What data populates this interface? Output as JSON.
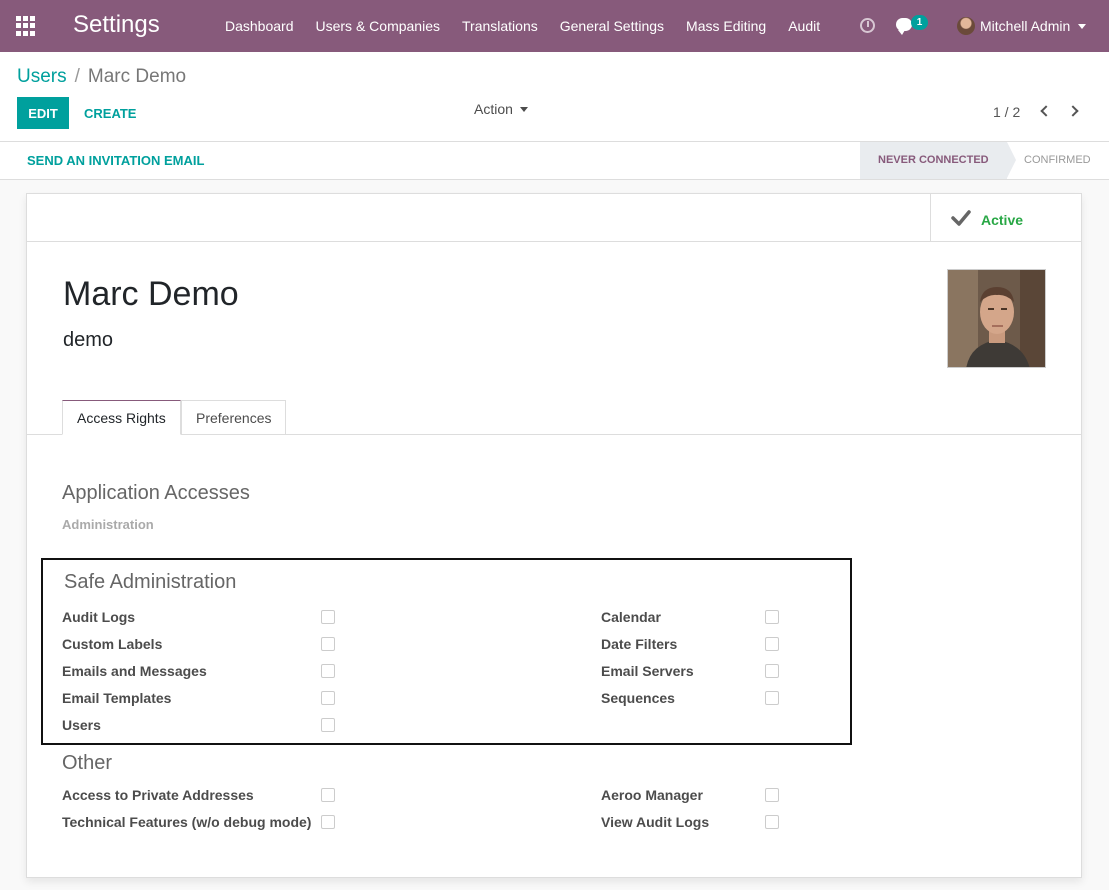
{
  "navbar": {
    "app_title": "Settings",
    "menu": [
      "Dashboard",
      "Users & Companies",
      "Translations",
      "General Settings",
      "Mass Editing",
      "Audit"
    ],
    "chat_badge": "1",
    "user_name": "Mitchell Admin"
  },
  "control_panel": {
    "breadcrumb_parent": "Users",
    "breadcrumb_separator": "/",
    "breadcrumb_current": "Marc Demo",
    "edit_label": "EDIT",
    "create_label": "CREATE",
    "action_label": "Action",
    "pager": "1 / 2"
  },
  "statusbar": {
    "invite_label": "SEND AN INVITATION EMAIL",
    "states": [
      "NEVER CONNECTED",
      "CONFIRMED"
    ],
    "current_state": "NEVER CONNECTED"
  },
  "record": {
    "active_label": "Active",
    "name": "Marc Demo",
    "login": "demo"
  },
  "tabs": [
    "Access Rights",
    "Preferences"
  ],
  "access_rights": {
    "application_accesses": {
      "title": "Application Accesses",
      "category": "Administration"
    },
    "safe_administration": {
      "title": "Safe Administration",
      "left": [
        {
          "label": "Audit Logs",
          "checked": false
        },
        {
          "label": "Custom Labels",
          "checked": false
        },
        {
          "label": "Emails and Messages",
          "checked": false
        },
        {
          "label": "Email Templates",
          "checked": false
        },
        {
          "label": "Users",
          "checked": false
        }
      ],
      "right": [
        {
          "label": "Calendar",
          "checked": false
        },
        {
          "label": "Date Filters",
          "checked": false
        },
        {
          "label": "Email Servers",
          "checked": false
        },
        {
          "label": "Sequences",
          "checked": false
        }
      ]
    },
    "other": {
      "title": "Other",
      "left": [
        {
          "label": "Access to Private Addresses",
          "checked": false
        },
        {
          "label": "Technical Features (w/o debug mode)",
          "checked": false
        }
      ],
      "right": [
        {
          "label": "Aeroo Manager",
          "checked": false
        },
        {
          "label": "View Audit Logs",
          "checked": false
        }
      ]
    }
  },
  "colors": {
    "brand": "#875a7b",
    "accent": "#00a09d",
    "active": "#28a745"
  }
}
